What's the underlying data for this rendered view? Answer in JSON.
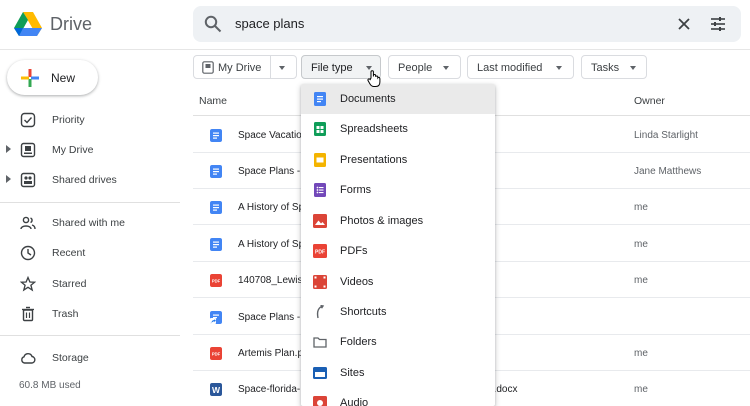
{
  "app": {
    "title": "Drive"
  },
  "search": {
    "query": "space plans"
  },
  "sidebar": {
    "new_label": "New",
    "items": [
      {
        "label": "Priority",
        "icon": "priority-icon"
      },
      {
        "label": "My Drive",
        "icon": "my-drive-icon"
      },
      {
        "label": "Shared drives",
        "icon": "shared-drives-icon"
      },
      {
        "label": "Shared with me",
        "icon": "shared-with-me-icon"
      },
      {
        "label": "Recent",
        "icon": "clock-icon"
      },
      {
        "label": "Starred",
        "icon": "star-icon"
      },
      {
        "label": "Trash",
        "icon": "trash-icon"
      },
      {
        "label": "Storage",
        "icon": "cloud-icon"
      }
    ],
    "storage_used": "60.8 MB used"
  },
  "filters": {
    "location": "My Drive",
    "file_type": "File type",
    "people": "People",
    "last_modified": "Last modified",
    "tasks": "Tasks"
  },
  "table": {
    "columns": {
      "name": "Name",
      "owner": "Owner"
    },
    "rows": [
      {
        "name": "Space Vacatio",
        "tail": "",
        "owner": "Linda Starlight",
        "type": "doc"
      },
      {
        "name": "Space Plans -",
        "tail": "",
        "owner": "Jane Matthews",
        "type": "doc"
      },
      {
        "name": "A History of Sp",
        "tail": "",
        "owner": "me",
        "type": "doc"
      },
      {
        "name": "A History of Sp",
        "tail": "",
        "owner": "me",
        "type": "doc"
      },
      {
        "name": "140708_Lewis",
        "tail": "",
        "owner": "me",
        "type": "pdf"
      },
      {
        "name": "Space Plans -",
        "tail": "",
        "owner": "",
        "type": "shortcut"
      },
      {
        "name": "Artemis Plan.p",
        "tail": "",
        "owner": "me",
        "type": "pdf"
      },
      {
        "name": "Space-florida-",
        "tail": "d.docx",
        "owner": "me",
        "type": "word"
      }
    ]
  },
  "file_type_menu": {
    "items": [
      {
        "label": "Documents",
        "icon": "document-icon",
        "color": "#4285f4"
      },
      {
        "label": "Spreadsheets",
        "icon": "spreadsheet-icon",
        "color": "#0f9d58"
      },
      {
        "label": "Presentations",
        "icon": "presentation-icon",
        "color": "#f4b400"
      },
      {
        "label": "Forms",
        "icon": "form-icon",
        "color": "#7248b9"
      },
      {
        "label": "Photos & images",
        "icon": "image-icon",
        "color": "#db4437"
      },
      {
        "label": "PDFs",
        "icon": "pdf-icon",
        "color": "#ea4335"
      },
      {
        "label": "Videos",
        "icon": "video-icon",
        "color": "#db4437"
      },
      {
        "label": "Shortcuts",
        "icon": "shortcut-icon",
        "color": "#5f6368"
      },
      {
        "label": "Folders",
        "icon": "folder-icon",
        "color": "#5f6368"
      },
      {
        "label": "Sites",
        "icon": "sites-icon",
        "color": "#1a5fb4"
      },
      {
        "label": "Audio",
        "icon": "audio-icon",
        "color": "#db4437"
      }
    ]
  },
  "colors": {
    "accent": "#4285f4",
    "doc": "#4285f4",
    "pdf": "#ea4335",
    "word": "#2b579a"
  }
}
